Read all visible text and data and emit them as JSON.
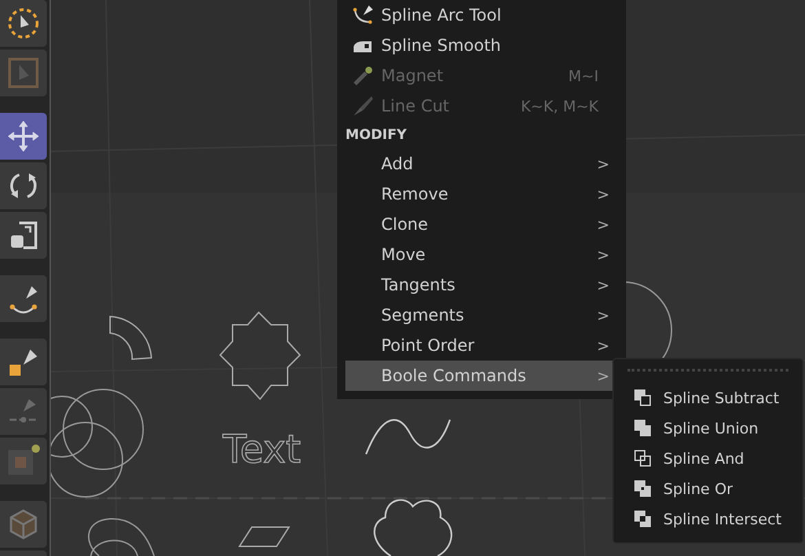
{
  "toolbar": {
    "tools": [
      {
        "kind": "live-select",
        "selected": false
      },
      {
        "kind": "box-select",
        "selected": false
      },
      {
        "kind": "gap"
      },
      {
        "kind": "move",
        "selected": true
      },
      {
        "kind": "rotate",
        "selected": false
      },
      {
        "kind": "scale",
        "selected": false
      },
      {
        "kind": "gap"
      },
      {
        "kind": "spline-arc",
        "selected": false
      },
      {
        "kind": "gap"
      },
      {
        "kind": "spline-pen",
        "selected": false
      },
      {
        "kind": "spline-cut",
        "selected": false
      },
      {
        "kind": "object-toggle",
        "selected": false
      },
      {
        "kind": "gap"
      },
      {
        "kind": "cube",
        "selected": false
      },
      {
        "kind": "partial",
        "selected": false
      }
    ]
  },
  "viewport": {
    "text_object": "Text"
  },
  "menu": {
    "items": [
      {
        "kind": "tool",
        "label": "Spline Arc Tool",
        "disabled": false
      },
      {
        "kind": "tool",
        "label": "Spline Smooth",
        "disabled": false
      },
      {
        "kind": "tool",
        "label": "Magnet",
        "shortcut": "M~I",
        "disabled": true
      },
      {
        "kind": "tool",
        "label": "Line Cut",
        "shortcut": "K~K, M~K",
        "disabled": true
      },
      {
        "kind": "header",
        "label": "MODIFY"
      },
      {
        "kind": "submenu",
        "label": "Add",
        "arrow": ">",
        "selected": false
      },
      {
        "kind": "submenu",
        "label": "Remove",
        "arrow": ">",
        "selected": false
      },
      {
        "kind": "submenu",
        "label": "Clone",
        "arrow": ">",
        "selected": false
      },
      {
        "kind": "submenu",
        "label": "Move",
        "arrow": ">",
        "selected": false
      },
      {
        "kind": "submenu",
        "label": "Tangents",
        "arrow": ">",
        "selected": false
      },
      {
        "kind": "submenu",
        "label": "Segments",
        "arrow": ">",
        "selected": false
      },
      {
        "kind": "submenu",
        "label": "Point Order",
        "arrow": ">",
        "selected": false
      },
      {
        "kind": "submenu",
        "label": "Boole Commands",
        "arrow": ">",
        "selected": true
      }
    ]
  },
  "submenu": {
    "items": [
      {
        "label": "Spline Subtract"
      },
      {
        "label": "Spline Union"
      },
      {
        "label": "Spline And"
      },
      {
        "label": "Spline Or"
      },
      {
        "label": "Spline Intersect"
      }
    ]
  }
}
